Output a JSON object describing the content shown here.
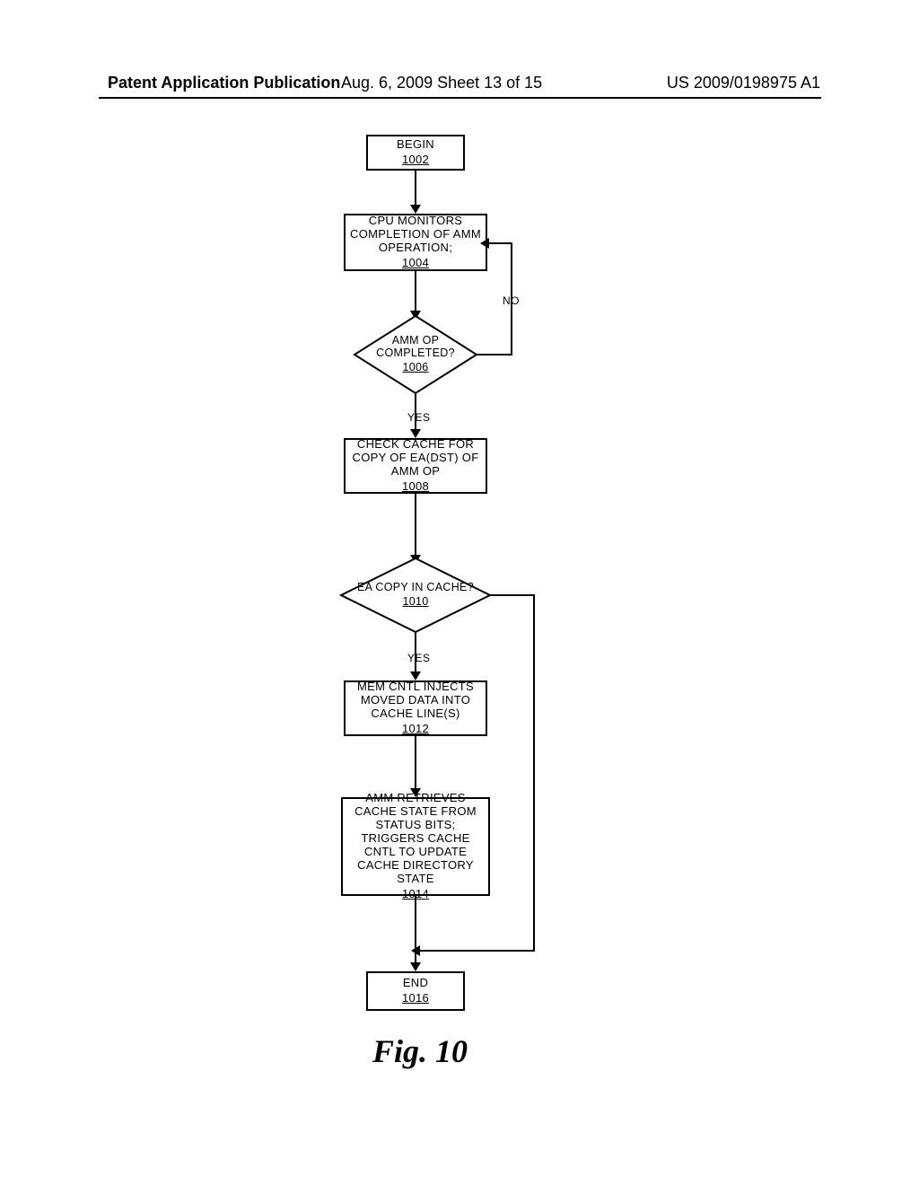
{
  "header": {
    "left": "Patent Application Publication",
    "mid": "Aug. 6, 2009  Sheet 13 of 15",
    "right": "US 2009/0198975 A1"
  },
  "nodes": {
    "begin": {
      "text": "BEGIN",
      "ref": "1002"
    },
    "monitor": {
      "text": "CPU MONITORS COMPLETION OF AMM OPERATION;",
      "ref": "1004"
    },
    "done": {
      "text": "AMM OP COMPLETED?",
      "ref": "1006"
    },
    "check": {
      "text": "CHECK CACHE FOR COPY OF EA(DST) OF AMM OP",
      "ref": "1008"
    },
    "eacopy": {
      "text": "EA COPY IN CACHE?",
      "ref": "1010"
    },
    "inject": {
      "text": "MEM CNTL INJECTS MOVED DATA INTO CACHE LINE(S)",
      "ref": "1012"
    },
    "state": {
      "text": "AMM RETRIEVES CACHE STATE FROM STATUS BITS; TRIGGERS CACHE CNTL TO UPDATE CACHE DIRECTORY STATE",
      "ref": "1014"
    },
    "end": {
      "text": "END",
      "ref": "1016"
    }
  },
  "labels": {
    "no": "NO",
    "yes1": "YES",
    "yes2": "YES"
  },
  "figure": "Fig. 10"
}
